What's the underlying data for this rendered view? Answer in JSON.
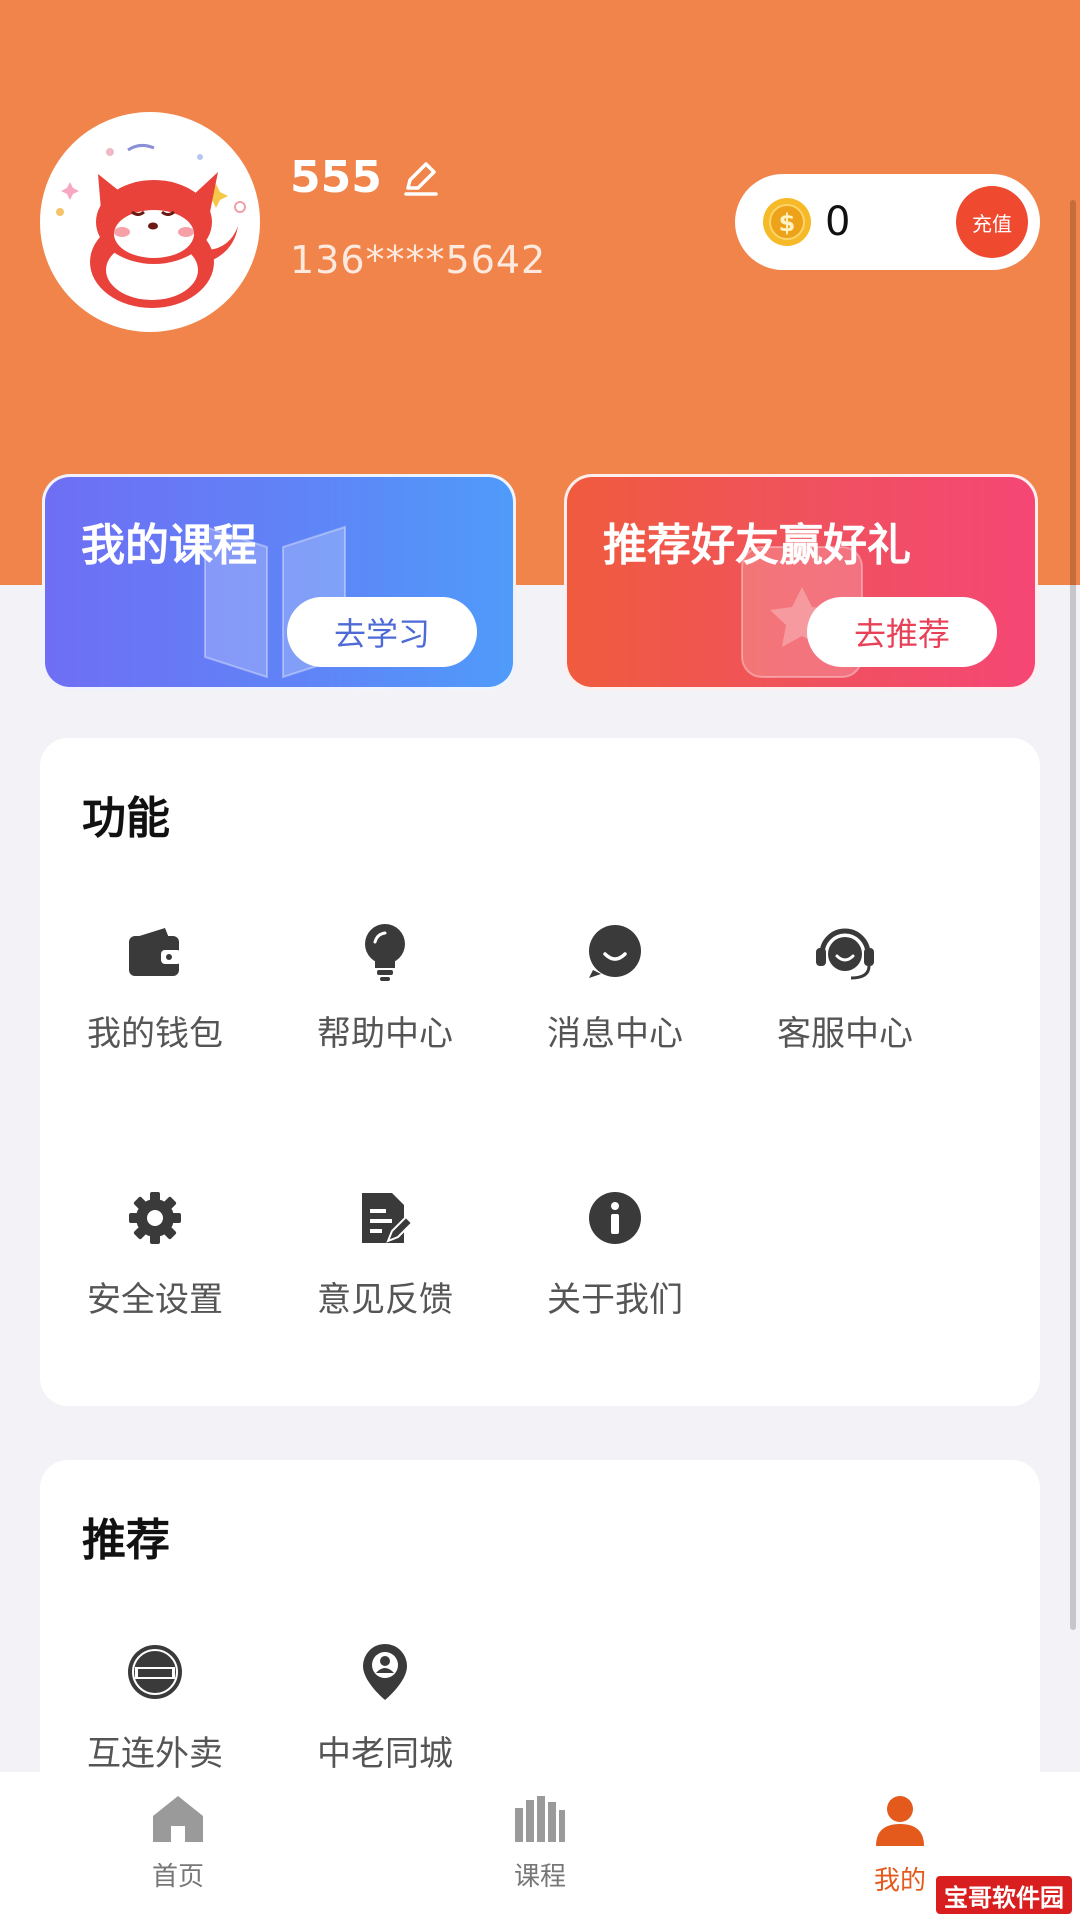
{
  "profile": {
    "name": "555",
    "phone": "136****5642"
  },
  "wallet": {
    "coins": "0",
    "recharge_label": "充值"
  },
  "promos": {
    "courses": {
      "title": "我的课程",
      "button": "去学习"
    },
    "referral": {
      "title": "推荐好友赢好礼",
      "button": "去推荐"
    }
  },
  "features": {
    "title": "功能",
    "items": [
      {
        "label": "我的钱包",
        "icon": "wallet-icon"
      },
      {
        "label": "帮助中心",
        "icon": "lightbulb-icon"
      },
      {
        "label": "消息中心",
        "icon": "message-icon"
      },
      {
        "label": "客服中心",
        "icon": "headset-icon"
      },
      {
        "label": "安全设置",
        "icon": "gear-icon"
      },
      {
        "label": "意见反馈",
        "icon": "feedback-icon"
      },
      {
        "label": "关于我们",
        "icon": "info-icon"
      }
    ]
  },
  "recommend": {
    "title": "推荐",
    "items": [
      {
        "label": "互连外卖",
        "icon": "hulian-logo-icon"
      },
      {
        "label": "中老同城",
        "icon": "location-pin-icon"
      }
    ]
  },
  "tabbar": {
    "items": [
      {
        "label": "首页",
        "icon": "home-icon",
        "active": false
      },
      {
        "label": "课程",
        "icon": "books-icon",
        "active": false
      },
      {
        "label": "我的",
        "icon": "user-icon",
        "active": true
      }
    ]
  },
  "watermark": "宝哥软件园",
  "colors": {
    "header": "#f1844a",
    "accent": "#e45a1c",
    "courses_card": "#5e86f7",
    "referral_card": "#f05062",
    "recharge": "#ef4a2f"
  }
}
